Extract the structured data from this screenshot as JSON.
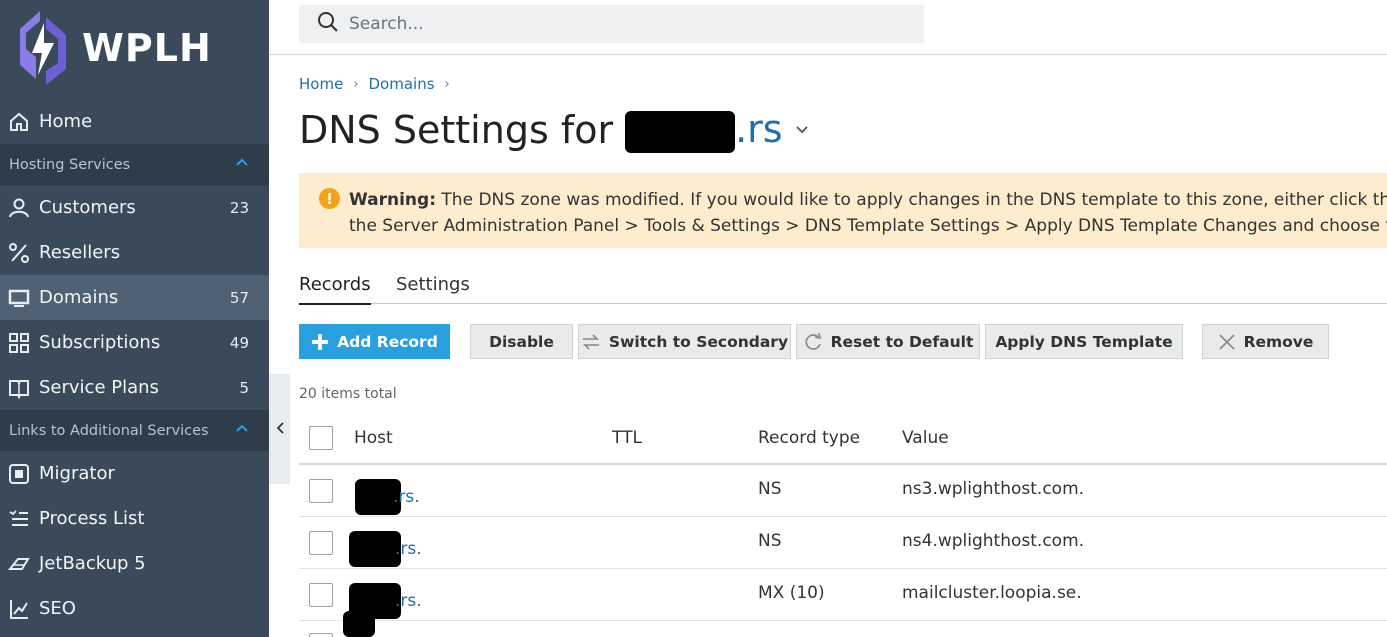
{
  "logo": {
    "text": "WPLH"
  },
  "sidebar": {
    "home": "Home",
    "sections": [
      {
        "label": "Hosting Services"
      },
      {
        "label": "Links to Additional Services"
      }
    ],
    "hosting_items": [
      {
        "label": "Customers",
        "count": "23",
        "icon": "user-icon"
      },
      {
        "label": "Resellers",
        "count": "",
        "icon": "percent-icon"
      },
      {
        "label": "Domains",
        "count": "57",
        "icon": "monitor-icon"
      },
      {
        "label": "Subscriptions",
        "count": "49",
        "icon": "grid-icon"
      },
      {
        "label": "Service Plans",
        "count": "5",
        "icon": "book-icon"
      }
    ],
    "link_items": [
      {
        "label": "Migrator",
        "icon": "migrator-icon"
      },
      {
        "label": "Process List",
        "icon": "list-icon"
      },
      {
        "label": "JetBackup 5",
        "icon": "jetbackup-icon"
      },
      {
        "label": "SEO",
        "icon": "chart-icon"
      }
    ]
  },
  "search": {
    "placeholder": "Search..."
  },
  "breadcrumb": [
    "Home",
    "Domains"
  ],
  "page": {
    "title_prefix": "DNS Settings for",
    "domain_visible": ".rs"
  },
  "warning": {
    "label": "Warning:",
    "line1": "The DNS zone was modified. If you would like to apply changes in the DNS template to this zone, either click the 'Apply",
    "line2": "the Server Administration Panel > Tools & Settings > DNS Template Settings > Apply DNS Template Changes and choose the 'App"
  },
  "tabs": [
    "Records",
    "Settings"
  ],
  "toolbar": {
    "add": "Add Record",
    "disable": "Disable",
    "switch": "Switch to Secondary",
    "reset": "Reset to Default",
    "apply": "Apply DNS Template",
    "remove": "Remove"
  },
  "total": "20 items total",
  "table": {
    "headers": [
      "Host",
      "TTL",
      "Record type",
      "Value"
    ],
    "rows": [
      {
        "host": ".rs.",
        "ttl": "",
        "type": "NS",
        "value": "ns3.wplighthost.com."
      },
      {
        "host": ".rs.",
        "ttl": "",
        "type": "NS",
        "value": "ns4.wplighthost.com."
      },
      {
        "host": ".rs.",
        "ttl": "",
        "type": "MX (10)",
        "value": "mailcluster.loopia.se."
      }
    ]
  },
  "colors": {
    "sidebar": "#3b4a5a",
    "accent": "#29a0de",
    "link": "#1f6fa8",
    "warning_bg": "#fdeccd"
  }
}
